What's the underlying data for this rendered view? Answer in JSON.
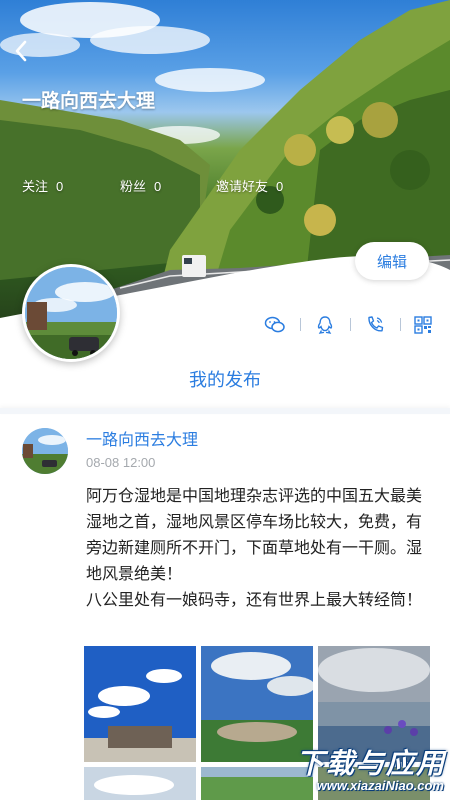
{
  "header": {
    "title": "一路向西去大理",
    "stats": [
      {
        "label": "关注",
        "value": "0"
      },
      {
        "label": "粉丝",
        "value": "0"
      },
      {
        "label": "邀请好友",
        "value": "0"
      }
    ],
    "edit_label": "编辑",
    "share_icons": [
      "wechat-icon",
      "qq-icon",
      "phone-icon",
      "qrcode-icon"
    ]
  },
  "section": {
    "title": "我的发布"
  },
  "post": {
    "author": "一路向西去大理",
    "time": "08-08 12:00",
    "text": "阿万仓湿地是中国地理杂志评选的中国五大最美湿地之首，湿地风景区停车场比较大，免费，有旁边新建厕所不开门，下面草地处有一干厕。湿地风景绝美！\n八公里处有一娘码寺，还有世界上最大转经筒！",
    "photo_count": 6
  },
  "watermark": {
    "main": "下载与应用",
    "sub": "www.xiazaiNiao.com"
  },
  "colors": {
    "accent": "#2b7de0",
    "text": "#222222",
    "muted": "#a5a9ae"
  }
}
